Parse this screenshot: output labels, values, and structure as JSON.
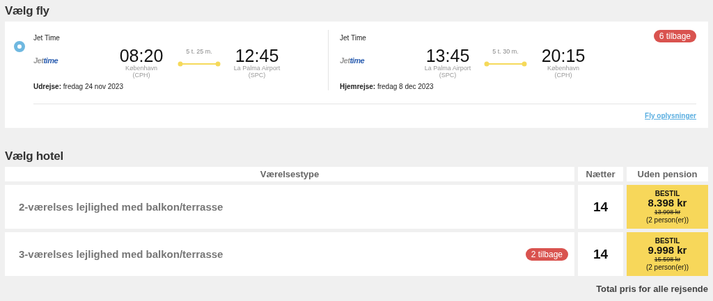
{
  "flights": {
    "heading": "Vælg fly",
    "selected": true,
    "remaining": "6 tilbage",
    "details_link": "Fly oplysninger",
    "legs": [
      {
        "airline": "Jet Time",
        "logo": [
          "Jet",
          "time"
        ],
        "depart_time": "08:20",
        "depart_place": "København",
        "depart_code": "(CPH)",
        "duration": "5 t. 25 m.",
        "arrive_time": "12:45",
        "arrive_place": "La Palma Airport",
        "arrive_code": "(SPC)",
        "date_label": "Udrejse:",
        "date": "fredag 24 nov 2023"
      },
      {
        "airline": "Jet Time",
        "logo": [
          "Jet",
          "time"
        ],
        "depart_time": "13:45",
        "depart_place": "La Palma Airport",
        "depart_code": "(SPC)",
        "duration": "5 t. 30 m.",
        "arrive_time": "20:15",
        "arrive_place": "København",
        "arrive_code": "(CPH)",
        "date_label": "Hjemrejse:",
        "date": "fredag 8 dec 2023"
      }
    ]
  },
  "hotel": {
    "heading": "Vælg hotel",
    "columns": [
      "Værelsestype",
      "Nætter",
      "Uden pension"
    ],
    "rows": [
      {
        "room": "2-værelses lejlighed med balkon/terrasse",
        "nights": "14",
        "book": "BESTIL",
        "price": "8.398 kr",
        "old_price": "13.998 kr",
        "persons": "(2 person(er))"
      },
      {
        "room": "3-værelses lejlighed med balkon/terrasse",
        "remaining": "2 tilbage",
        "nights": "14",
        "book": "BESTIL",
        "price": "9.998 kr",
        "old_price": "15.598 kr",
        "persons": "(2 person(er))"
      }
    ],
    "total_label": "Total pris for alle rejsende"
  }
}
